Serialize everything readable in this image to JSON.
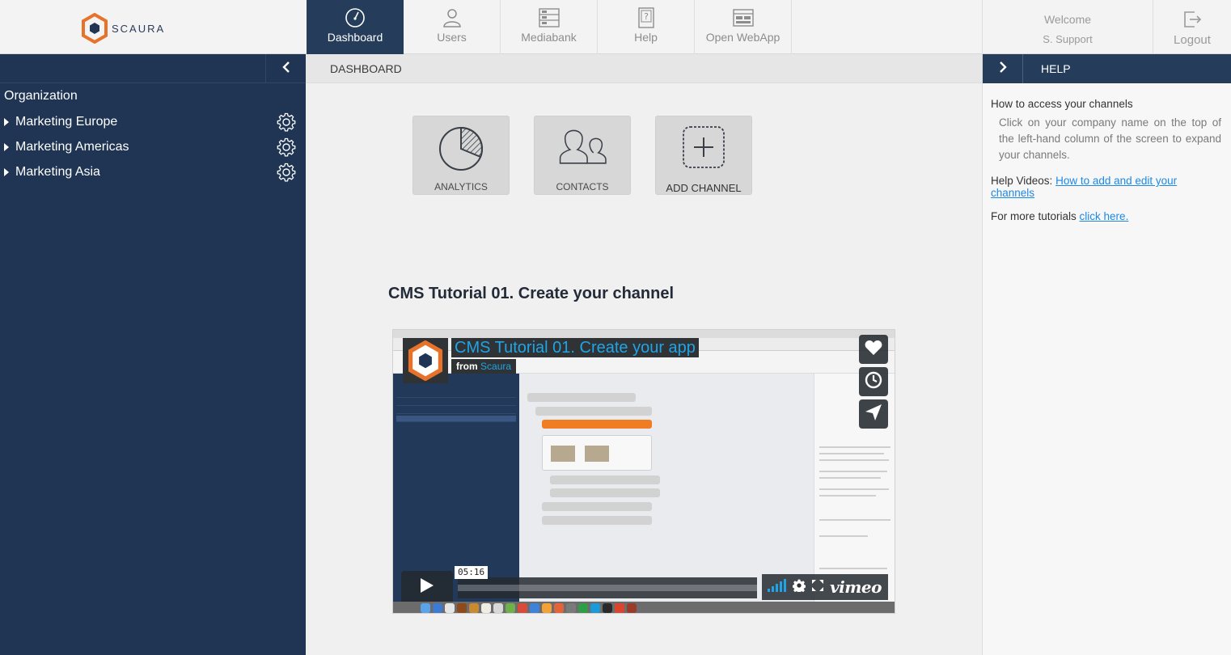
{
  "brand": {
    "name": "SCAURA",
    "accent": "#e8722a",
    "navy": "#1f3553"
  },
  "nav": [
    {
      "label": "Dashboard",
      "icon": "dashboard-gauge-icon",
      "active": true
    },
    {
      "label": "Users",
      "icon": "user-icon",
      "active": false
    },
    {
      "label": "Mediabank",
      "icon": "mediabank-icon",
      "active": false
    },
    {
      "label": "Help",
      "icon": "help-icon",
      "active": false
    },
    {
      "label": "Open WebApp",
      "icon": "webapp-icon",
      "active": false
    }
  ],
  "user": {
    "welcome": "Welcome",
    "name": "S. Support",
    "logout": "Logout"
  },
  "sidebar": {
    "title": "Organization",
    "items": [
      {
        "label": "Marketing Europe"
      },
      {
        "label": "Marketing Americas"
      },
      {
        "label": "Marketing Asia"
      }
    ]
  },
  "main": {
    "breadcrumb": "DASHBOARD",
    "tiles": [
      {
        "label": "ANALYTICS",
        "icon": "pie-chart-icon"
      },
      {
        "label": "CONTACTS",
        "icon": "contacts-icon"
      },
      {
        "label": "ADD CHANNEL",
        "icon": "plus-icon"
      }
    ],
    "video_heading": "CMS Tutorial 01. Create your channel"
  },
  "video": {
    "title": "CMS Tutorial 01. Create your app",
    "from": "from",
    "channel": "Scaura",
    "time": "05:16",
    "provider": "vimeo"
  },
  "help": {
    "title": "HELP",
    "question": "How to access your channels",
    "answer": "Click on your company name on the top of the left-hand column of the screen to expand your channels.",
    "videos_label": "Help Videos:",
    "videos_link": "How to add and edit your channels",
    "tutorials_label": "For more tutorials",
    "tutorials_link": "click here."
  }
}
